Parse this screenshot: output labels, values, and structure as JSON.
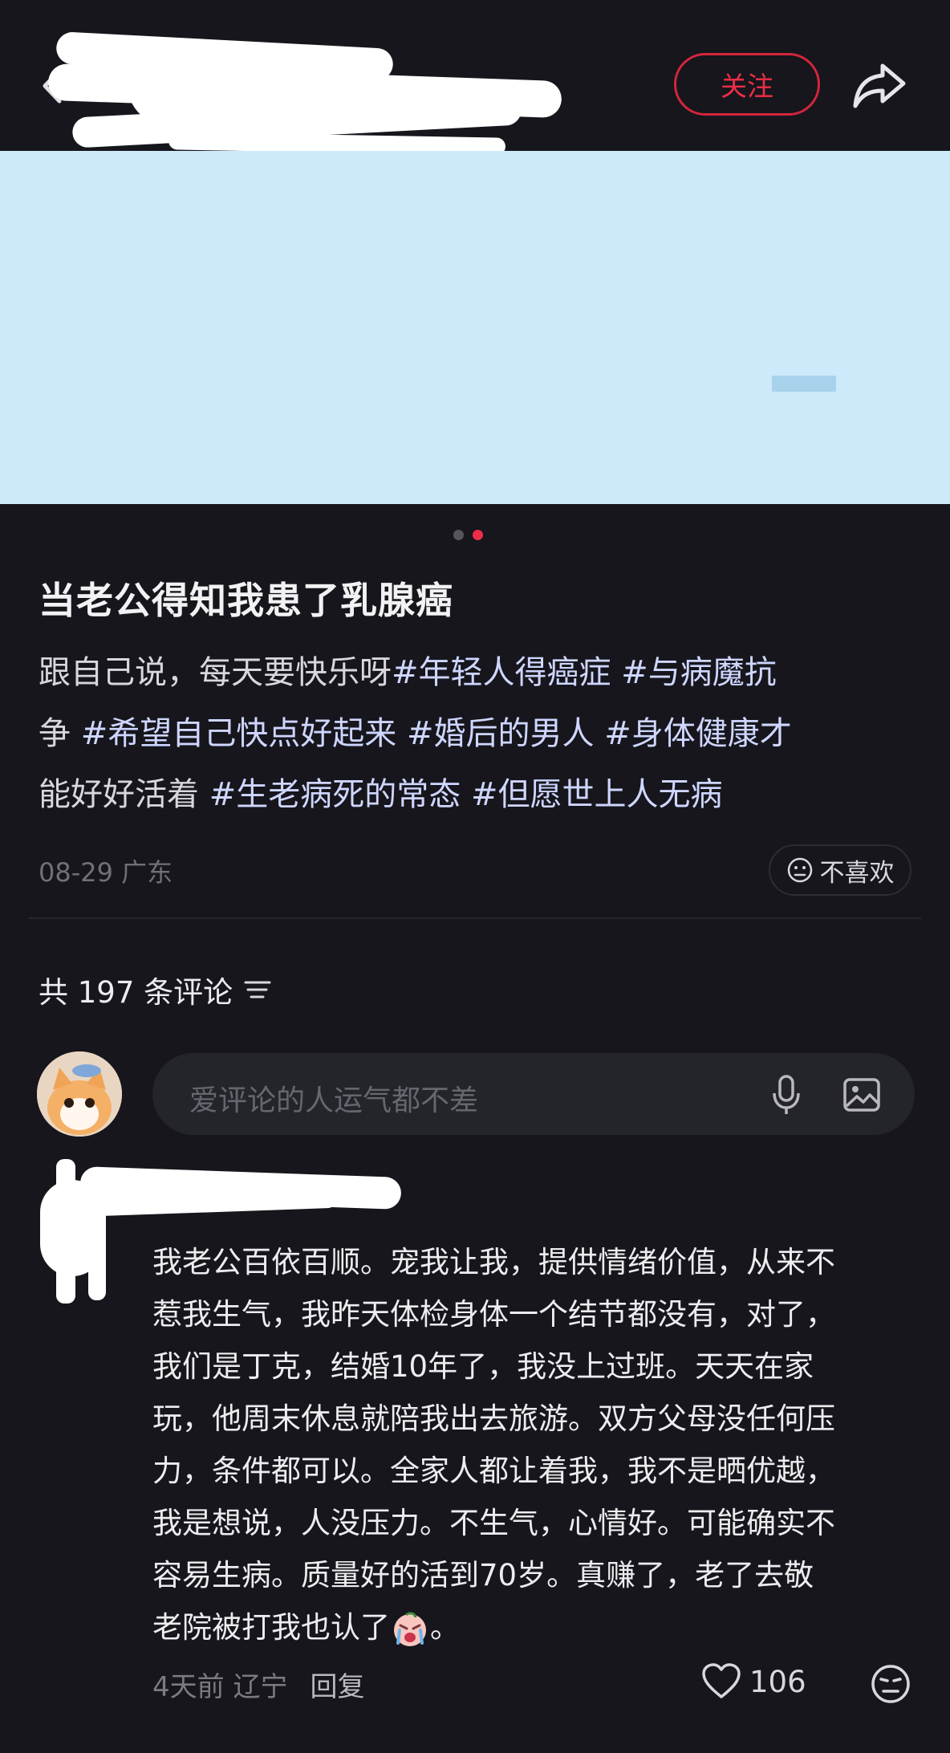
{
  "header": {
    "follow_label": "关注",
    "icons": {
      "back": "chevron-left-icon",
      "share": "share-icon"
    }
  },
  "media": {
    "dots": 2,
    "active_dot": 2,
    "accent_color": "#ef2d48"
  },
  "post": {
    "title": "当老公得知我患了乳腺癌",
    "body_lines": [
      [
        "跟自己说，每天要快乐呀",
        "#年轻人得癌症",
        " ",
        "#与病魔抗"
      ],
      [
        "争",
        " ",
        "#希望自己快点好起来",
        " ",
        "#婚后的男人",
        " ",
        "#身体健康才"
      ],
      [
        "能好好活着",
        " ",
        "#生老病死的常态",
        " ",
        "#但愿世上人无病"
      ]
    ],
    "body_plain": "跟自己说，每天要快乐呀#年轻人得癌症 #与病魔抗争 #希望自己快点好起来 #婚后的男人 #身体健康才能好好活着 #生老病死的常态 #但愿世上人无病",
    "date_location": "08-29 广东",
    "dislike_label": "不喜欢"
  },
  "comments": {
    "count_label": "共 197 条评论",
    "input_placeholder": "爱评论的人运气都不差",
    "items": [
      {
        "lines": [
          "我老公百依百顺。宠我让我，提供情绪价值，从来不",
          "惹我生气，我昨天体检身体一个结节都没有，对了，",
          "我们是丁克，结婚10年了，我没上过班。天天在家",
          "玩，他周末休息就陪我出去旅游。双方父母没任何压",
          "力，条件都可以。全家人都让着我，我不是晒优越，",
          "我是想说，人没压力。不生气，心情好。可能确实不",
          "容易生病。质量好的活到70岁。真赚了，老了去敬",
          "老院被打我也认了"
        ],
        "tail": "。",
        "time": "4天前",
        "location": "辽宁",
        "reply_label": "回复",
        "likes": "106"
      }
    ]
  }
}
